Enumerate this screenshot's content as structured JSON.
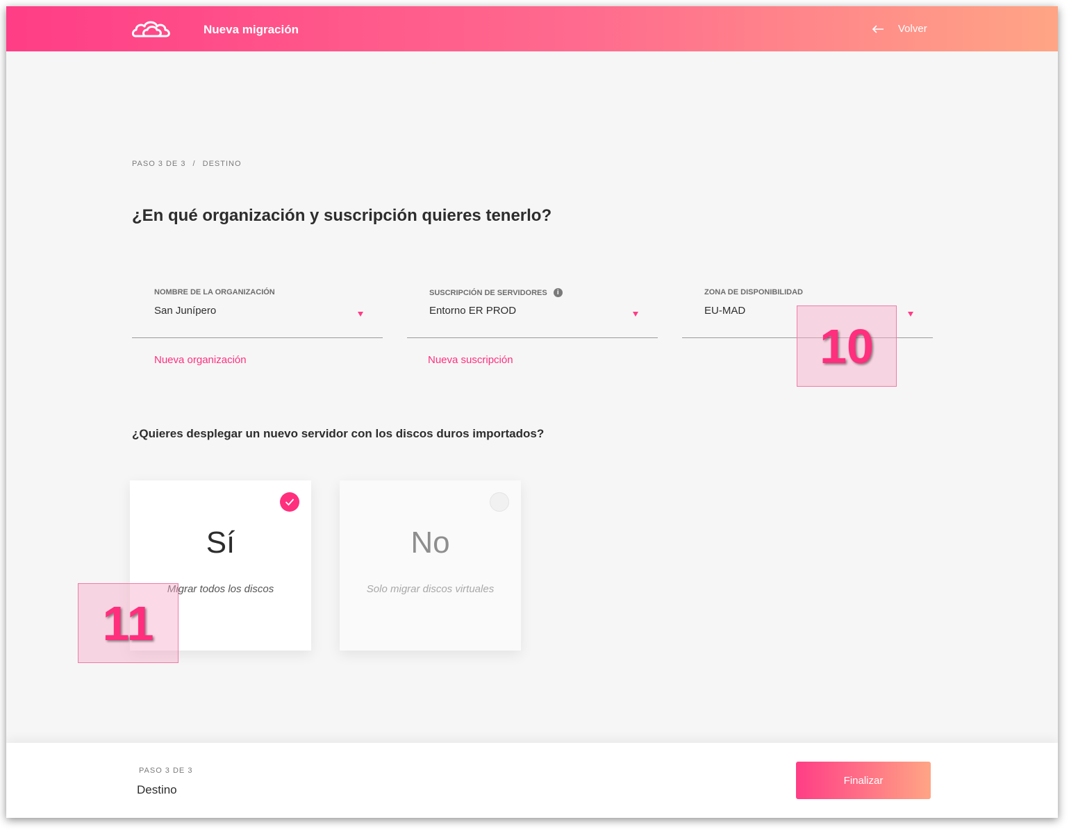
{
  "header": {
    "title": "Nueva migración",
    "back_label": "Volver"
  },
  "breadcrumb": {
    "step": "PASO 3 DE 3",
    "separator": "/",
    "section": "DESTINO"
  },
  "question": "¿En qué organización y suscripción quieres tenerlo?",
  "fields": {
    "organization": {
      "label": "NOMBRE DE LA ORGANIZACIÓN",
      "value": "San Junípero",
      "link": "Nueva organización"
    },
    "subscription": {
      "label": "SUSCRIPCIÓN DE SERVIDORES",
      "value": "Entorno ER PROD",
      "link": "Nueva suscripción",
      "info_icon": "info-icon"
    },
    "zone": {
      "label": "ZONA DE DISPONIBILIDAD",
      "value": "EU-MAD"
    }
  },
  "deploy_question": "¿Quieres desplegar un nuevo servidor con los discos duros importados?",
  "options": {
    "yes": {
      "title": "Sí",
      "subtitle": "Migrar todos los discos",
      "selected": true
    },
    "no": {
      "title": "No",
      "subtitle": "Solo migrar discos virtuales",
      "selected": false
    }
  },
  "annotations": {
    "a10": "10",
    "a11": "11"
  },
  "footer": {
    "step": "PASO 3 DE 3",
    "step_name": "Destino",
    "finish_label": "Finalizar"
  },
  "colors": {
    "accent": "#ff2f7d",
    "gradient_start": "#ff3d86",
    "gradient_end": "#ffa585"
  }
}
